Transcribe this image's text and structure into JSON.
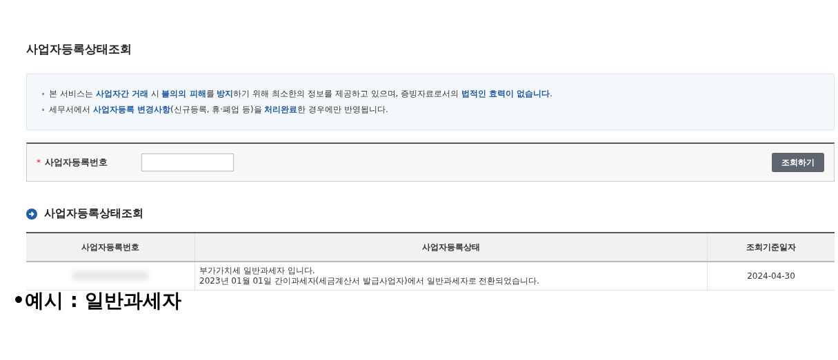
{
  "page_title": "사업자등록상태조회",
  "notices": [
    "본 서비스는 **사업자간 거래** 시 **불의의 피해**를 **방지**하기 위해 최소한의 정보를 제공하고 있으며, 증빙자료로서의 **법적인 효력이 없습니다**.",
    "세무서에서 **사업자등록 변경사항**(신규등록, 휴·폐업 등)을 **처리완료**한 경우에만 반영됩니다."
  ],
  "search": {
    "required_mark": "*",
    "label": "사업자등록번호",
    "button": "조회하기"
  },
  "result_title": "사업자등록상태조회",
  "table": {
    "columns": [
      "사업자등록번호",
      "사업자등록상태",
      "조회기준일자"
    ],
    "rows": [
      {
        "status_lines": [
          "부가가치세 일반과세자 입니다.",
          "2023년 01월 01일 간이과세자(세금계산서 발급사업자)에서 일반과세자로 전환되었습니다."
        ],
        "date": "2024-04-30"
      }
    ]
  },
  "caption": "•예시 : 일반과세자"
}
